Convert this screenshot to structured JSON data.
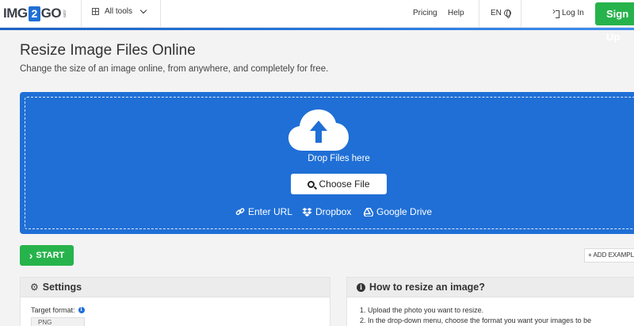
{
  "header": {
    "logo": {
      "left": "IMG",
      "mid": "2",
      "right": "GO",
      "small": ".com"
    },
    "all_tools": "All tools",
    "nav": {
      "pricing": "Pricing",
      "help": "Help"
    },
    "language": "EN",
    "login": "Log In",
    "signup": "Sign Up",
    "accent_color": "#1f6fd6",
    "signup_color": "#27b34b"
  },
  "page": {
    "title": "Resize Image Files Online",
    "subtitle": "Change the size of an image online, from anywhere, and completely for free."
  },
  "upload": {
    "drop_text": "Drop Files here",
    "choose_file": "Choose File",
    "sources": {
      "url": "Enter URL",
      "dropbox": "Dropbox",
      "gdrive": "Google Drive"
    },
    "background": "#1f6fd6"
  },
  "actions": {
    "start": "START",
    "add_example": "ADD EXAMPLE"
  },
  "settings": {
    "title": "Settings",
    "target_format_label": "Target format:",
    "target_format_value": "PNG"
  },
  "howto": {
    "title": "How to resize an image?",
    "steps": [
      "1. Upload the photo you want to resize.",
      "2. In the drop-down menu, choose the format you want your images to be"
    ]
  }
}
